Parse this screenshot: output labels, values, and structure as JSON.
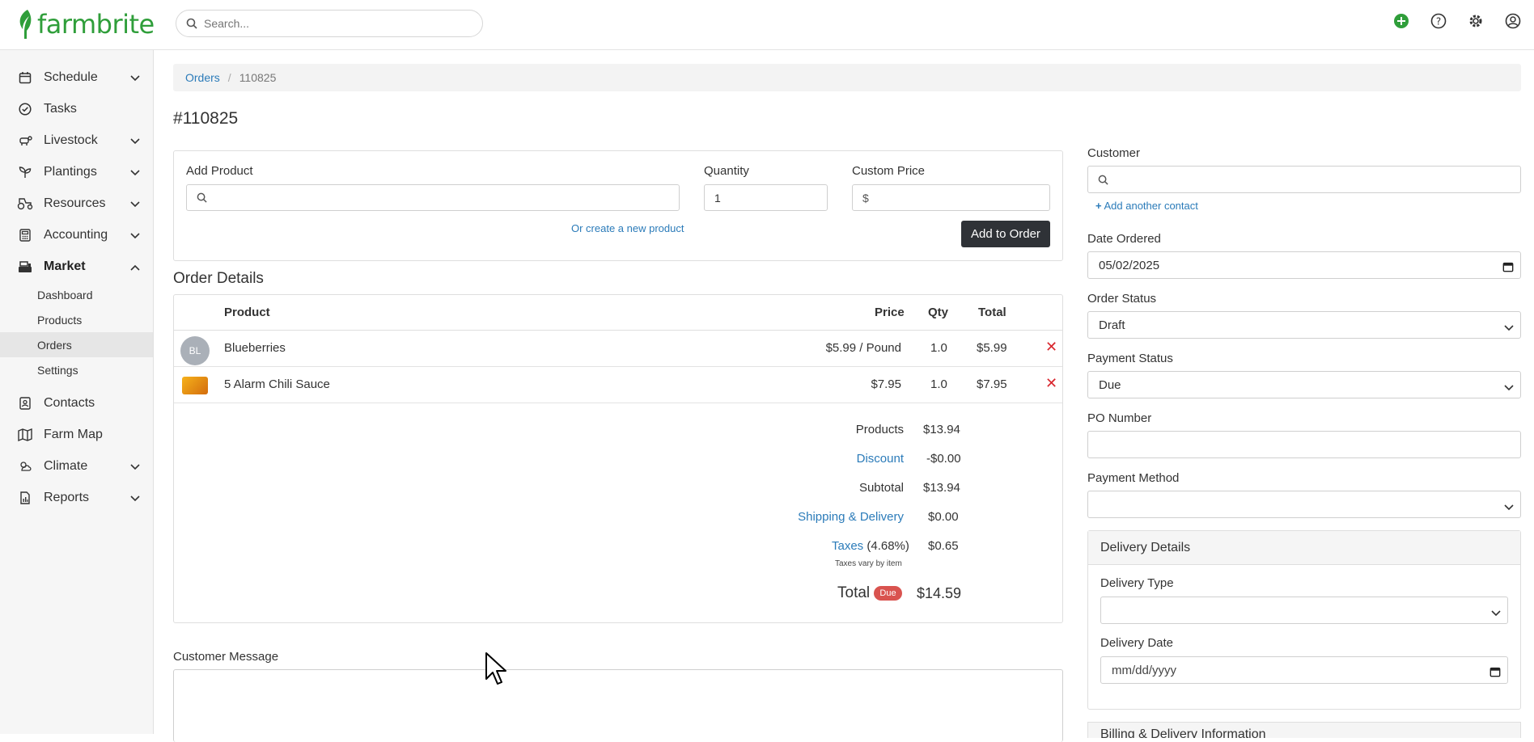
{
  "brand": {
    "name": "farmbrite",
    "color": "#2f9e3a"
  },
  "search": {
    "placeholder": "Search..."
  },
  "top_icons": [
    "add-circle-icon",
    "help-icon",
    "gear-icon",
    "account-icon"
  ],
  "sidebar": {
    "items": [
      {
        "label": "Schedule",
        "icon": "calendar-icon",
        "expandable": true
      },
      {
        "label": "Tasks",
        "icon": "check-circle-icon",
        "expandable": false
      },
      {
        "label": "Livestock",
        "icon": "cow-icon",
        "expandable": true
      },
      {
        "label": "Plantings",
        "icon": "sprout-icon",
        "expandable": true
      },
      {
        "label": "Resources",
        "icon": "tractor-icon",
        "expandable": true
      },
      {
        "label": "Accounting",
        "icon": "calculator-icon",
        "expandable": true
      },
      {
        "label": "Market",
        "icon": "register-icon",
        "expandable": true,
        "expanded": true
      },
      {
        "label": "Contacts",
        "icon": "contacts-icon",
        "expandable": false
      },
      {
        "label": "Farm Map",
        "icon": "map-icon",
        "expandable": false
      },
      {
        "label": "Climate",
        "icon": "weather-icon",
        "expandable": true
      },
      {
        "label": "Reports",
        "icon": "report-icon",
        "expandable": true
      }
    ],
    "market_sub": [
      "Dashboard",
      "Products",
      "Orders",
      "Settings"
    ],
    "active_sub": "Orders"
  },
  "breadcrumb": {
    "parent": "Orders",
    "current": "110825"
  },
  "page_title": "#110825",
  "add_product": {
    "product_label": "Add Product",
    "quantity_label": "Quantity",
    "quantity_value": "1",
    "custom_price_label": "Custom Price",
    "custom_price_prefix": "$",
    "create_link": "Or create a new product",
    "add_button": "Add to Order"
  },
  "order_details": {
    "title": "Order Details",
    "columns": {
      "product": "Product",
      "price": "Price",
      "qty": "Qty",
      "total": "Total"
    },
    "rows": [
      {
        "avatar": "BL",
        "product": "Blueberries",
        "price": "$5.99 / Pound",
        "qty": "1.0",
        "total": "$5.99"
      },
      {
        "avatar": "",
        "product": "5 Alarm Chili Sauce",
        "price": "$7.95",
        "qty": "1.0",
        "total": "$7.95"
      }
    ],
    "summary": {
      "products_label": "Products",
      "products_value": "$13.94",
      "discount_label": "Discount",
      "discount_value": "-$0.00",
      "subtotal_label": "Subtotal",
      "subtotal_value": "$13.94",
      "shipping_label": "Shipping & Delivery",
      "shipping_value": "$0.00",
      "taxes_label": "Taxes",
      "taxes_rate": "(4.68%)",
      "taxes_value": "$0.65",
      "taxes_note": "Taxes vary by item",
      "total_label": "Total",
      "total_badge": "Due",
      "total_value": "$14.59"
    }
  },
  "customer_message": {
    "label": "Customer Message"
  },
  "right": {
    "customer_label": "Customer",
    "add_contact": "Add another contact",
    "date_ordered_label": "Date Ordered",
    "date_ordered_value": "05/02/2025",
    "order_status_label": "Order Status",
    "order_status_value": "Draft",
    "payment_status_label": "Payment Status",
    "payment_status_value": "Due",
    "po_number_label": "PO Number",
    "payment_method_label": "Payment Method",
    "delivery": {
      "title": "Delivery Details",
      "type_label": "Delivery Type",
      "date_label": "Delivery Date",
      "date_placeholder": "mm/dd/yyyy"
    },
    "billing_title": "Billing & Delivery Information"
  }
}
